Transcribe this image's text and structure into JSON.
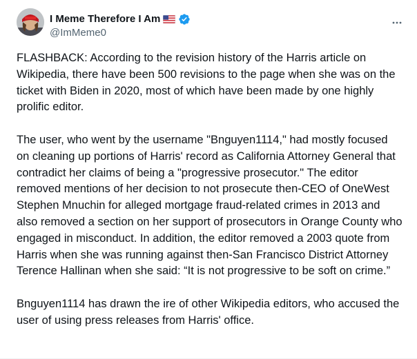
{
  "author": {
    "display_name": "I Meme Therefore I Am",
    "handle": "@ImMeme0",
    "flag_icon": "us-flag-icon",
    "verified_icon": "verified-badge-icon",
    "verified_color": "#1d9bf0"
  },
  "actions": {
    "more_icon": "more-options-icon"
  },
  "tweet": {
    "paragraphs": [
      "FLASHBACK: According to the revision history of the Harris article on Wikipedia, there have been 500 revisions to the page when she was on the ticket with Biden in 2020, most of which have been made by one highly prolific editor.",
      "The user, who went by the username \"Bnguyen1114,\" had mostly focused on cleaning up portions of Harris' record as California Attorney General that contradict her claims of being a \"progressive prosecutor.\" The editor removed mentions of her decision to not prosecute then-CEO of OneWest Stephen Mnuchin for alleged mortgage fraud-related crimes in 2013 and also removed a section on her support of prosecutors in Orange County who engaged in misconduct. In addition, the editor removed a 2003 quote from Harris when she was running against then-San Francisco District Attorney Terence Hallinan when she said: “It is not progressive to be soft on crime.”",
      "Bnguyen1114 has drawn the ire of other Wikipedia editors, who accused the user of using press releases from Harris' office."
    ]
  }
}
